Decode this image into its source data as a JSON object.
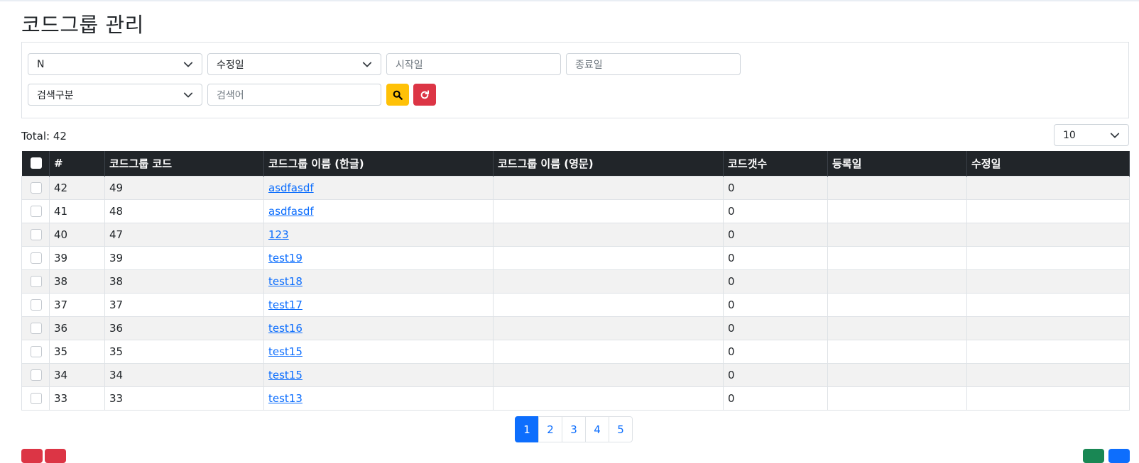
{
  "page": {
    "title": "코드그룹 관리"
  },
  "search": {
    "use_select": "N",
    "date_type_select": "수정일",
    "start_date_placeholder": "시작일",
    "end_date_placeholder": "종료일",
    "search_type_select": "검색구분",
    "keyword_placeholder": "검색어"
  },
  "summary": {
    "total_label": "Total: 42",
    "page_size": "10"
  },
  "table": {
    "headers": [
      "#",
      "코드그룹 코드",
      "코드그룹 이름 (한글)",
      "코드그룹 이름 (영문)",
      "코드갯수",
      "등록일",
      "수정일"
    ],
    "rows": [
      {
        "num": "42",
        "code": "49",
        "name_ko": "asdfasdf",
        "name_en": "",
        "count": "0",
        "reg": "",
        "mod": ""
      },
      {
        "num": "41",
        "code": "48",
        "name_ko": "asdfasdf",
        "name_en": "",
        "count": "0",
        "reg": "",
        "mod": ""
      },
      {
        "num": "40",
        "code": "47",
        "name_ko": "123",
        "name_en": "",
        "count": "0",
        "reg": "",
        "mod": ""
      },
      {
        "num": "39",
        "code": "39",
        "name_ko": "test19",
        "name_en": "",
        "count": "0",
        "reg": "",
        "mod": ""
      },
      {
        "num": "38",
        "code": "38",
        "name_ko": "test18",
        "name_en": "",
        "count": "0",
        "reg": "",
        "mod": ""
      },
      {
        "num": "37",
        "code": "37",
        "name_ko": "test17",
        "name_en": "",
        "count": "0",
        "reg": "",
        "mod": ""
      },
      {
        "num": "36",
        "code": "36",
        "name_ko": "test16",
        "name_en": "",
        "count": "0",
        "reg": "",
        "mod": ""
      },
      {
        "num": "35",
        "code": "35",
        "name_ko": "test15",
        "name_en": "",
        "count": "0",
        "reg": "",
        "mod": ""
      },
      {
        "num": "34",
        "code": "34",
        "name_ko": "test15",
        "name_en": "",
        "count": "0",
        "reg": "",
        "mod": ""
      },
      {
        "num": "33",
        "code": "33",
        "name_ko": "test13",
        "name_en": "",
        "count": "0",
        "reg": "",
        "mod": ""
      }
    ]
  },
  "pagination": {
    "pages": [
      "1",
      "2",
      "3",
      "4",
      "5"
    ],
    "current": "1"
  },
  "icons": {
    "search": "search-icon",
    "reset": "refresh-icon",
    "select": "chevron-down-icon"
  },
  "colors": {
    "search_button": "#ffc107",
    "reset_button": "#dc3545",
    "header_bg": "#212529",
    "link": "#0d6efd",
    "excel_button": "#198754",
    "register_button": "#0d6efd"
  }
}
